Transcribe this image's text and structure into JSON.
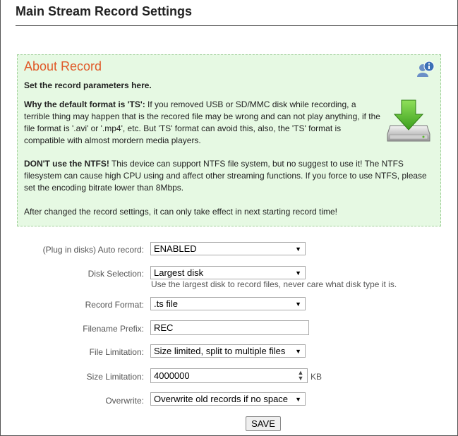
{
  "page": {
    "title": "Main Stream Record Settings"
  },
  "about": {
    "heading": "About Record",
    "intro": "Set the record parameters here.",
    "ts_bold": "Why the default format is 'TS':",
    "ts_text": " If you removed USB or SD/MMC disk while recording, a terrible thing may happen that is the recored file may be wrong and can not play anything, if the file format is '.avi' or '.mp4', etc. But 'TS' format can avoid this, also, the 'TS' format is compatible with almost mordern media players.",
    "ntfs_bold": "DON'T use the NTFS!",
    "ntfs_text": " This device can support NTFS file system, but no suggest to use it! The NTFS filesystem can cause high CPU using and affect other streaming functions. If you force to use NTFS, please set the encoding bitrate lower than 8Mbps.",
    "after": "After changed the record settings, it can only take effect in next starting record time!",
    "help_icon": "help-info-icon",
    "download_icon": "download-disk-icon"
  },
  "form": {
    "auto_record": {
      "label": "(Plug in disks) Auto record:",
      "value": "ENABLED"
    },
    "disk_selection": {
      "label": "Disk Selection:",
      "value": "Largest disk",
      "hint": "Use the largest disk to record files, never care what disk type it is."
    },
    "record_format": {
      "label": "Record Format:",
      "value": ".ts file"
    },
    "filename_prefix": {
      "label": "Filename Prefix:",
      "value": "REC"
    },
    "file_limitation": {
      "label": "File Limitation:",
      "value": "Size limited, split to multiple files"
    },
    "size_limitation": {
      "label": "Size Limitation:",
      "value": "4000000",
      "unit": "KB"
    },
    "overwrite": {
      "label": "Overwrite:",
      "value": "Overwrite old records if no space"
    },
    "save_label": "SAVE"
  },
  "colors": {
    "about_bg": "#e6f9e3",
    "about_heading": "#e05a2a",
    "download_green": "#5cb82e"
  }
}
